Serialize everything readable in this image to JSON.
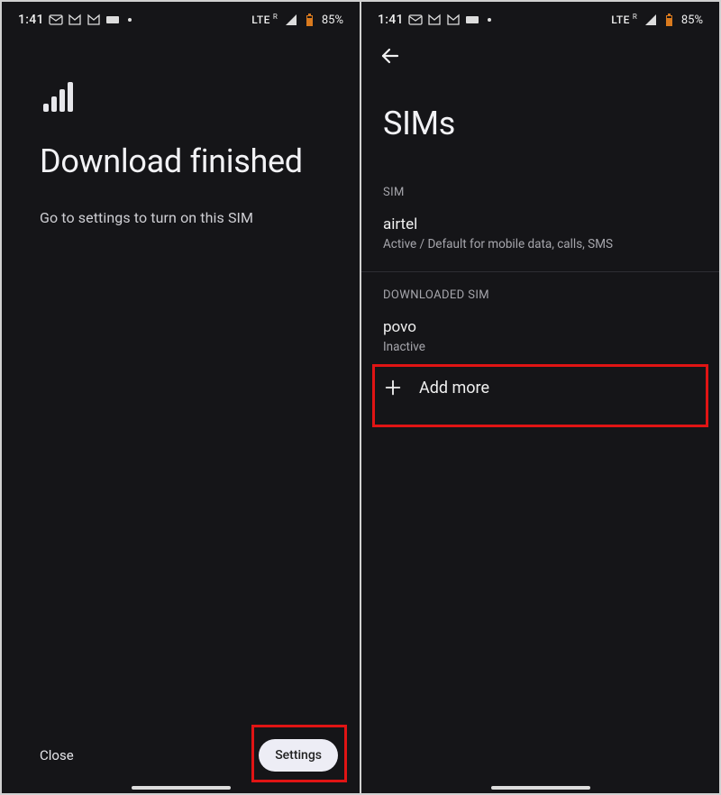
{
  "status": {
    "time": "1:41",
    "lte_label": "LTE",
    "roaming_indicator": "R",
    "battery_percent": "85%"
  },
  "screen_left": {
    "title": "Download finished",
    "subtitle": "Go to settings to turn on this SIM",
    "close_label": "Close",
    "settings_label": "Settings"
  },
  "screen_right": {
    "title": "SIMs",
    "section_sim_label": "SIM",
    "section_downloaded_label": "DOWNLOADED SIM",
    "sim_primary": {
      "name": "airtel",
      "status": "Active / Default for mobile data, calls, SMS"
    },
    "sim_downloaded": {
      "name": "povo",
      "status": "Inactive"
    },
    "add_more_label": "Add more"
  }
}
